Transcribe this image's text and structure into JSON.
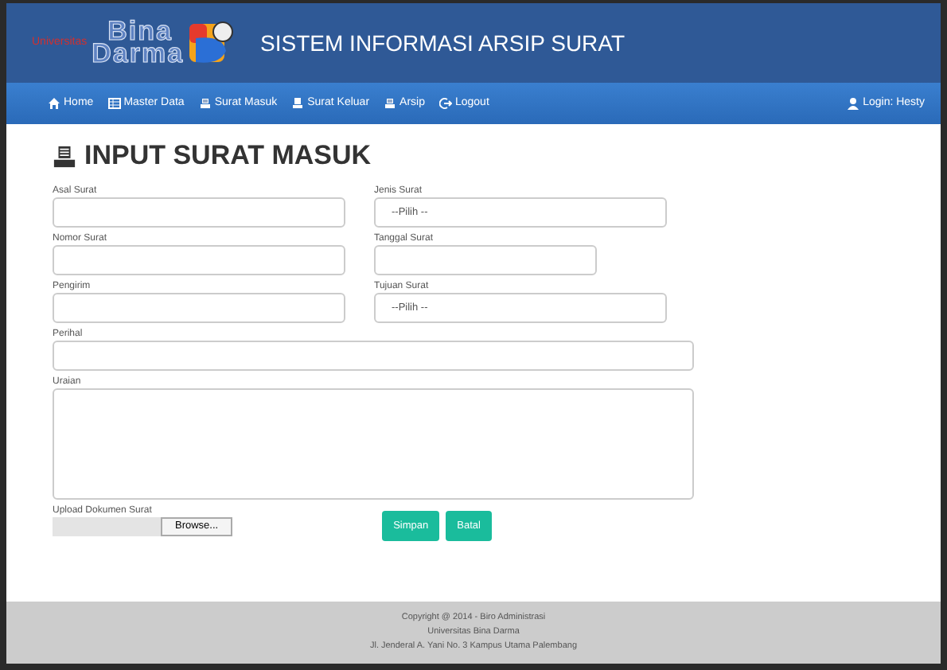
{
  "header": {
    "logo": {
      "small": "Universitas",
      "line_1": "Bina",
      "line_2": "Darma"
    },
    "title": "SISTEM INFORMASI ARSIP SURAT"
  },
  "nav": {
    "items": [
      {
        "label": "Home"
      },
      {
        "label": "Master Data"
      },
      {
        "label": "Surat Masuk"
      },
      {
        "label": "Surat Keluar"
      },
      {
        "label": "Arsip"
      },
      {
        "label": "Logout"
      }
    ],
    "user": "Login: Hesty"
  },
  "page_title": "INPUT SURAT MASUK",
  "form": {
    "rows": [
      [
        {
          "label": "Asal Surat",
          "kind": "text"
        },
        {
          "label": "Jenis Surat",
          "kind": "select",
          "value": "--Pilih --"
        }
      ],
      [
        {
          "label": "Nomor Surat",
          "kind": "text"
        },
        {
          "label": "Tanggal Surat",
          "kind": "date"
        }
      ],
      [
        {
          "label": "Pengirim",
          "kind": "text"
        },
        {
          "label": "Tujuan Surat",
          "kind": "select",
          "value": "--Pilih --"
        }
      ],
      [
        {
          "label": "Perihal",
          "kind": "wide"
        }
      ],
      [
        {
          "label": "Uraian",
          "kind": "textarea"
        }
      ]
    ],
    "upload": {
      "label": "Upload Dokumen Surat",
      "button": "Browse..."
    },
    "buttons": [
      "Simpan",
      "Batal"
    ]
  },
  "footer": [
    "Copyright @ 2014 - Biro Administrasi",
    "Universitas Bina Darma",
    "Jl. Jenderal A. Yani No. 3 Kampus Utama Palembang"
  ]
}
